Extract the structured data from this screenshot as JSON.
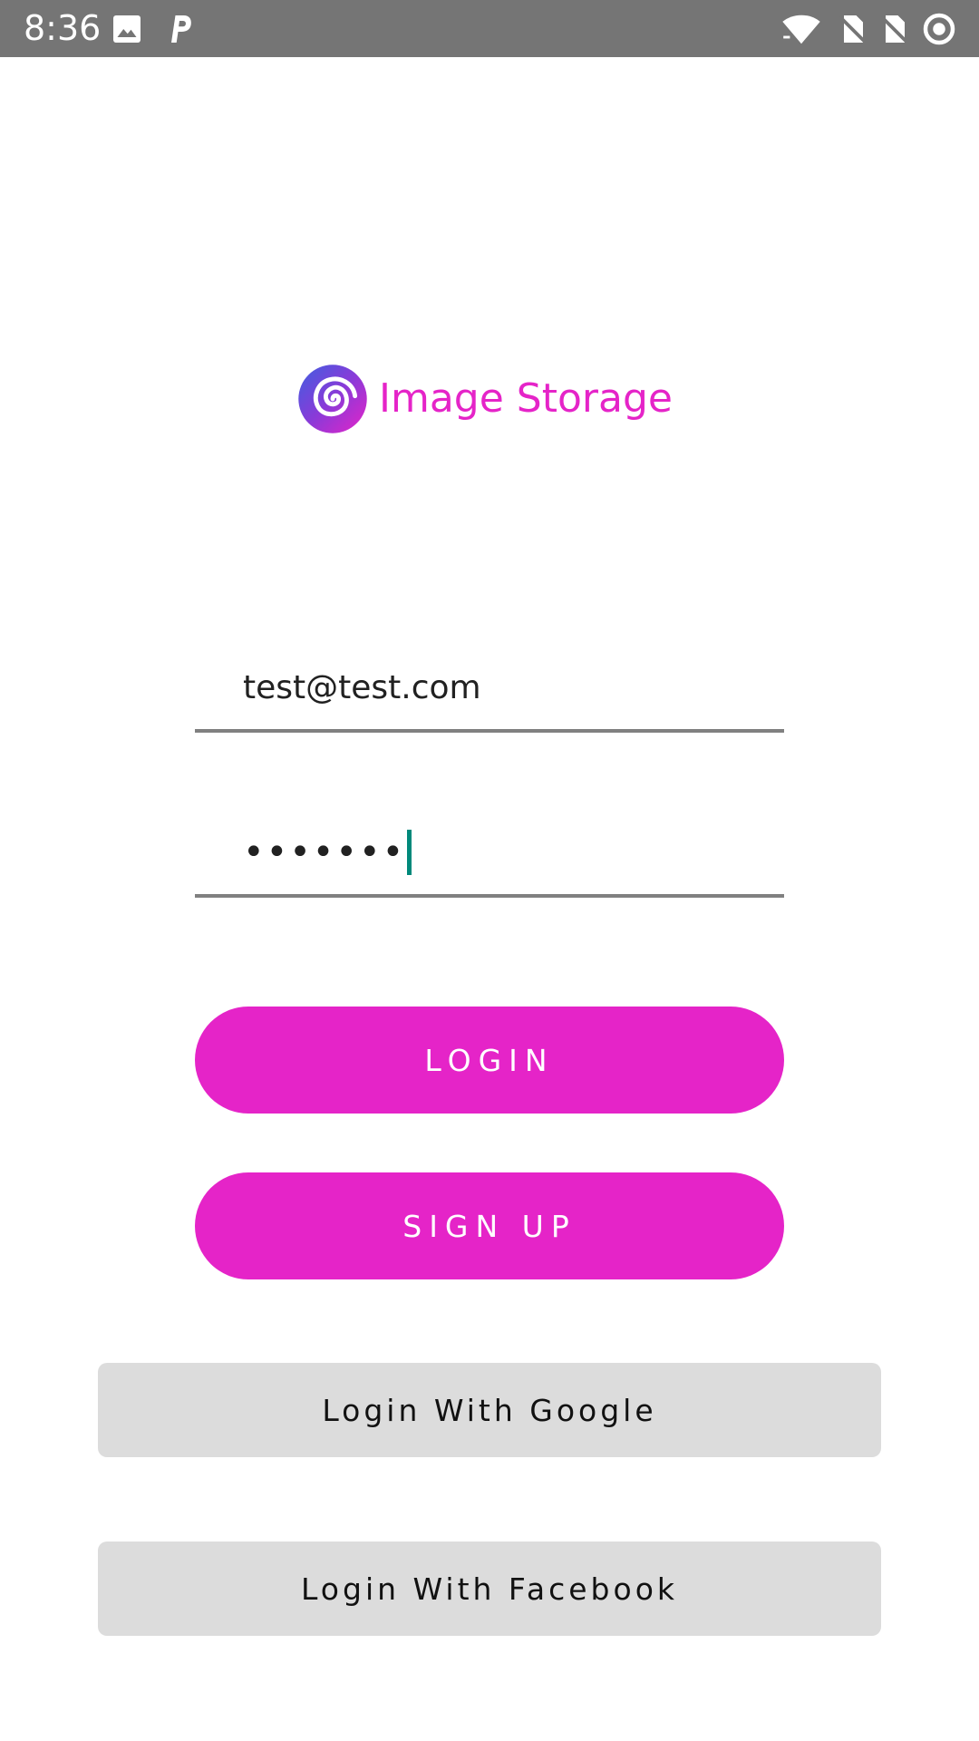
{
  "status_bar": {
    "time": "8:36",
    "left_icons": [
      "image-notification-icon",
      "parking-notification-icon"
    ],
    "right_icons": [
      "wifi-icon",
      "no-sim-icon",
      "no-sim-icon",
      "sync-icon"
    ]
  },
  "logo": {
    "text": "Image Storage",
    "icon": "spiral-logo-icon"
  },
  "form": {
    "email": {
      "value": "test@test.com"
    },
    "password": {
      "masked_value": "•••••••"
    }
  },
  "buttons": {
    "login": "LOGIN",
    "signup": "SIGN UP",
    "google": "Login With Google",
    "facebook": "Login With Facebook"
  },
  "colors": {
    "accent": "#e524c8",
    "status_bar": "#757575",
    "social_button_bg": "#dcdcdc",
    "caret": "#00897b",
    "underline": "#808080"
  }
}
